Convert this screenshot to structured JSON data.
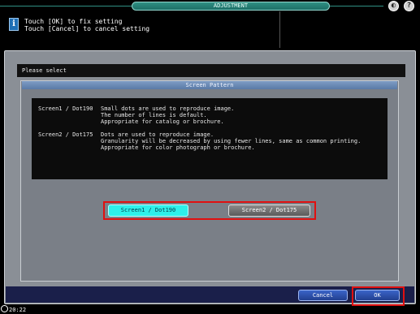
{
  "header": {
    "title": "ADJUSTMENT",
    "message_line1": "Touch [OK] to fix setting",
    "message_line2": "Touch [Cancel] to cancel setting",
    "info_icon": "i"
  },
  "dialog": {
    "prompt": "Please select",
    "panel_title": "Screen Pattern",
    "descriptions": [
      {
        "name": "Screen1 / Dot190",
        "lines": [
          "Small dots are used to reproduce image.",
          "The number of lines is default.",
          "Appropriate for catalog or brochure."
        ]
      },
      {
        "name": "Screen2 / Dot175",
        "lines": [
          "Dots are used to reproduce image.",
          "Granularity will be decreased by using fewer lines, same as common printing.",
          "Appropriate for color photograph or brochure."
        ]
      }
    ],
    "options": {
      "option1": "Screen1 / Dot190",
      "option2": "Screen2 / Dot175",
      "selected": "Screen1 / Dot190"
    },
    "cancel_label": "Cancel",
    "ok_label": "OK"
  },
  "status": {
    "time": "20:22"
  },
  "icons": [
    "speaker-icon",
    "help-icon",
    "info-icon",
    "clock-icon"
  ],
  "colors": {
    "selected_option": "#2ef0ea",
    "highlight_frame": "#e01010",
    "title_bar": "#2f8f83"
  }
}
